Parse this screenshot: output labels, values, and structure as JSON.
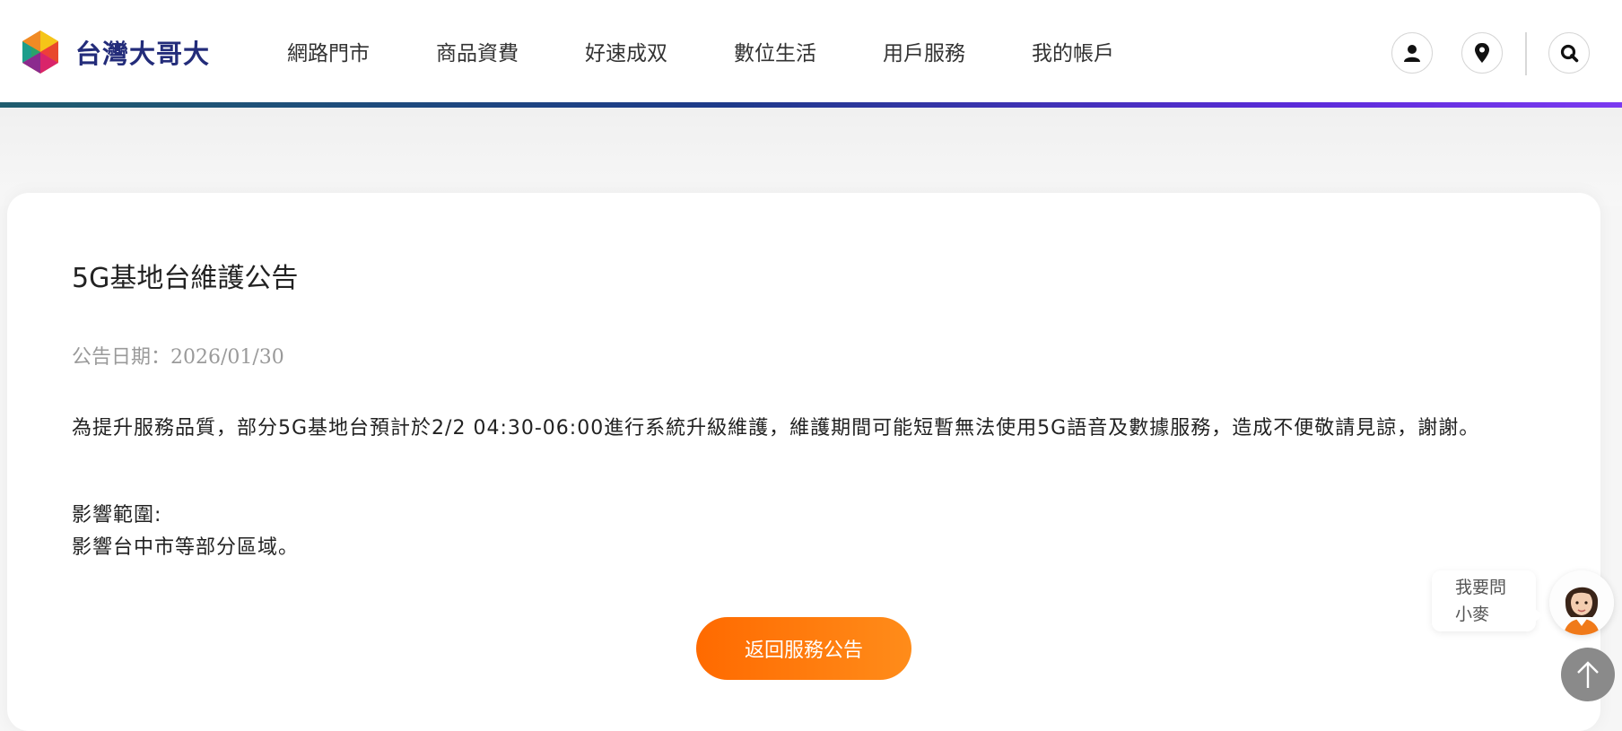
{
  "header": {
    "brand_name": "台灣大哥大",
    "nav": [
      {
        "label": "網路門市"
      },
      {
        "label": "商品資費"
      },
      {
        "label": "好速成双"
      },
      {
        "label": "數位生活"
      },
      {
        "label": "用戶服務"
      },
      {
        "label": "我的帳戶"
      }
    ],
    "icons": [
      "user-icon",
      "location-pin-icon",
      "search-icon"
    ],
    "accent_gradient": [
      "#1f5d6e",
      "#1e3a8a",
      "#7b3af0"
    ]
  },
  "announcement": {
    "title": "5G基地台維護公告",
    "date_label": "公告日期：2026/01/30",
    "body": "為提升服務品質，部分5G基地台預計於2/2 04:30-06:00進行系統升級維護，維護期間可能短暫無法使用5G語音及數據服務，造成不便敬請見諒，謝謝。",
    "scope_label": "影響範圍:",
    "scope_text": "影響台中市等部分區域。"
  },
  "back_button": {
    "label": "返回服務公告",
    "color": "#ff7a00"
  },
  "chat": {
    "line1": "我要問",
    "line2": "小麥"
  },
  "colors": {
    "brand_text": "#232c7a",
    "date_text": "#9a9a9a"
  }
}
